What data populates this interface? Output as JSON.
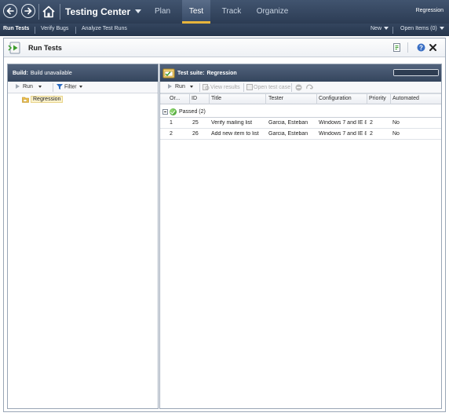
{
  "topbar": {
    "app_title": "Testing Center",
    "tabs": [
      {
        "label": "Plan"
      },
      {
        "label": "Test"
      },
      {
        "label": "Track"
      },
      {
        "label": "Organize"
      }
    ],
    "test_plan": "Regression"
  },
  "subnav": {
    "items": [
      {
        "label": "Run Tests"
      },
      {
        "label": "Verify Bugs"
      },
      {
        "label": "Analyze Test Runs"
      }
    ],
    "new_label": "New",
    "open_items_label": "Open Items (0)"
  },
  "page": {
    "title": "Run Tests"
  },
  "left_pane": {
    "build_label": "Build:",
    "build_value": "Build unavailable",
    "toolbar": {
      "run_label": "Run",
      "filter_label": "Filter"
    },
    "tree": [
      {
        "label": "Regression"
      }
    ]
  },
  "right_pane": {
    "suite_label": "Test suite:",
    "suite_value": "Regression",
    "toolbar": {
      "run_label": "Run",
      "view_results_label": "View results",
      "open_test_case_label": "Open test case"
    },
    "columns": [
      "Or...",
      "ID",
      "Title",
      "Tester",
      "Configuration",
      "Priority",
      "Automated"
    ],
    "group": {
      "label": "Passed (2)"
    },
    "rows": [
      {
        "order": "1",
        "id": "25",
        "title": "Verify mailing list",
        "tester": "Garcia, Esteban",
        "configuration": "Windows 7 and IE 8",
        "priority": "2",
        "automated": "No"
      },
      {
        "order": "2",
        "id": "26",
        "title": "Add new item to list",
        "tester": "Garcia, Esteban",
        "configuration": "Windows 7 and IE 8",
        "priority": "2",
        "automated": "No"
      }
    ]
  },
  "colors": {
    "topbar": "#34465f",
    "active_tab_underline": "#e6b43c",
    "pane_header": "#3e5068",
    "selection": "#fbf2cc",
    "passed": "#2f8f1f"
  }
}
